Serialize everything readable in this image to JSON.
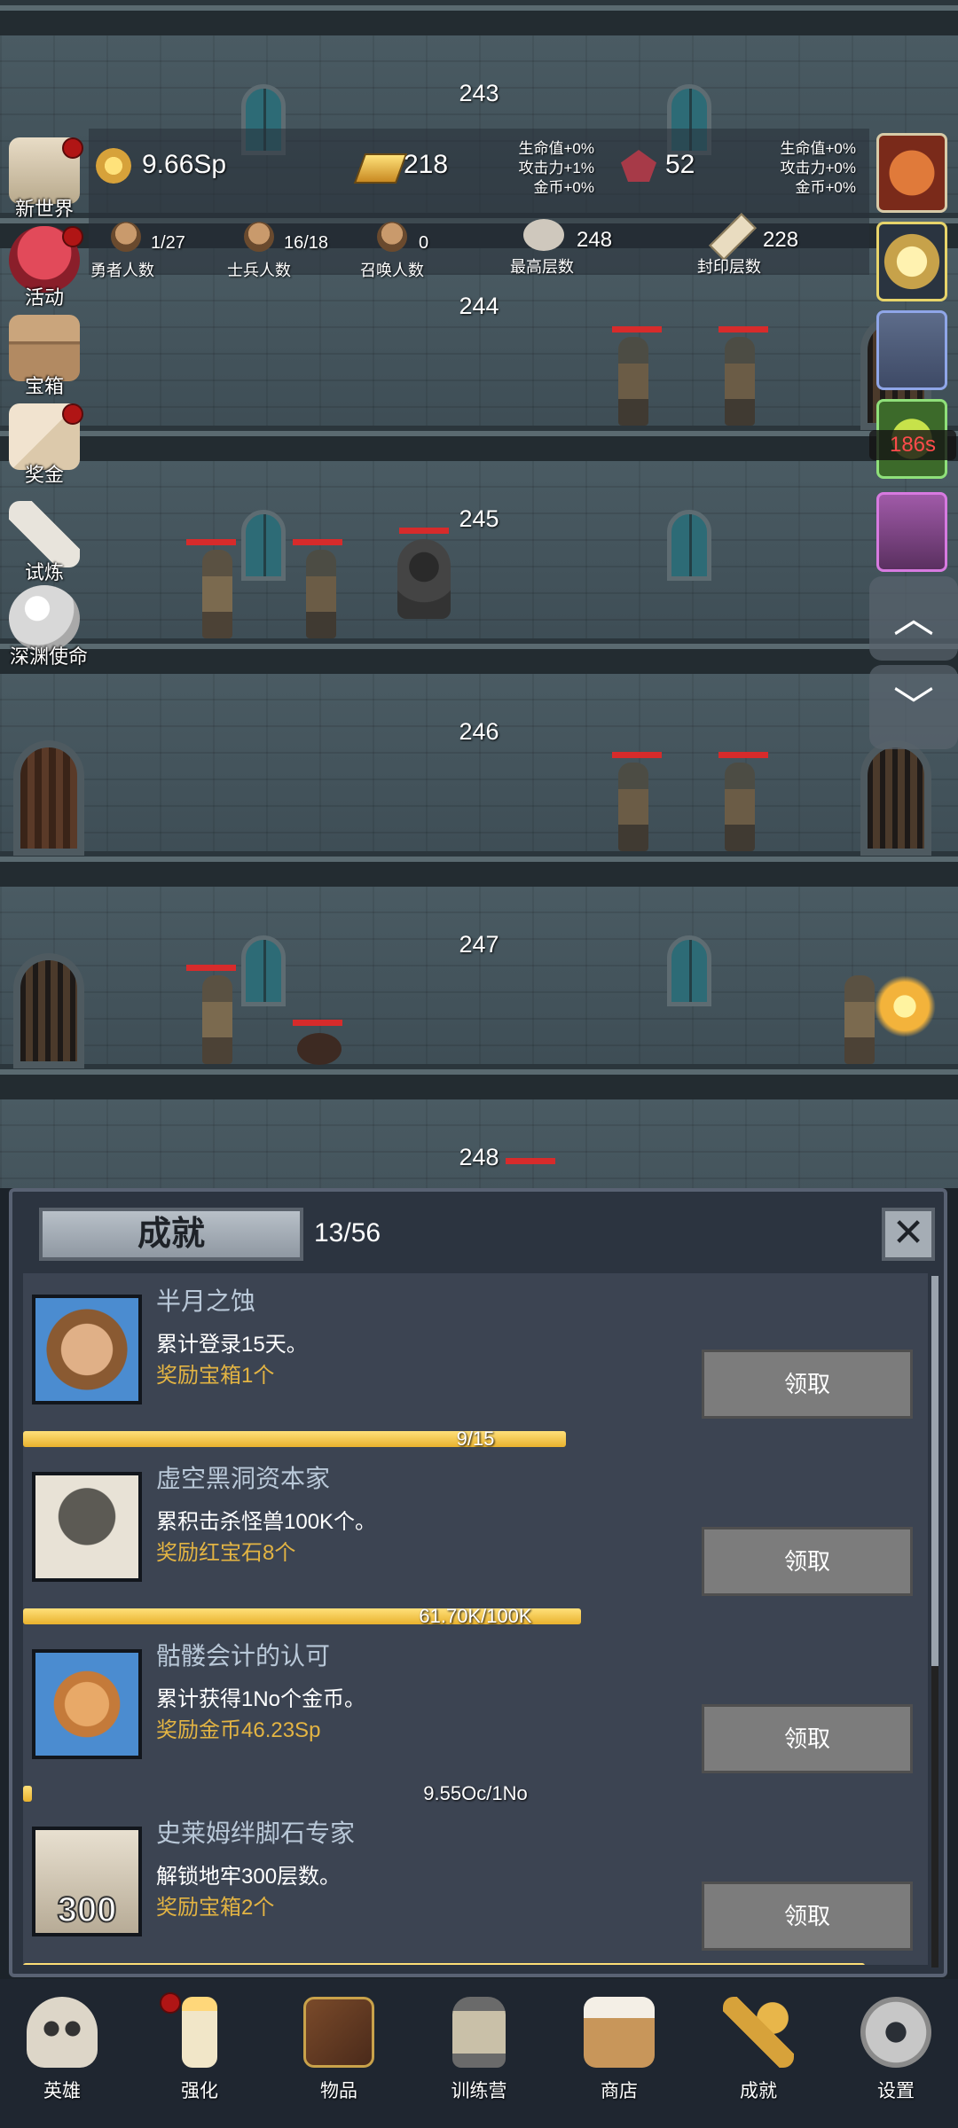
{
  "floors": [
    "243",
    "244",
    "245",
    "246",
    "247",
    "248"
  ],
  "hud": {
    "coins": "9.66Sp",
    "gold_bars": "218",
    "rubies": "52",
    "bonus_left": [
      "生命值+0%",
      "攻击力+1%",
      "金币+0%"
    ],
    "bonus_right": [
      "生命值+0%",
      "攻击力+0%",
      "金币+0%"
    ],
    "heroes": {
      "count": "1/27",
      "label": "勇者人数"
    },
    "soldiers": {
      "count": "16/18",
      "label": "士兵人数"
    },
    "summons": {
      "count": "0",
      "label": "召唤人数"
    },
    "max_floor": {
      "count": "248",
      "label": "最高层数"
    },
    "sealed_floor": {
      "count": "228",
      "label": "封印层数"
    }
  },
  "side_menu": [
    {
      "label": "新世界",
      "icon": "ruins-icon",
      "badge": true
    },
    {
      "label": "活动",
      "icon": "heart-icon",
      "badge": true
    },
    {
      "label": "宝箱",
      "icon": "treasure-chest-icon",
      "badge": false
    },
    {
      "label": "奖金",
      "icon": "letter-icon",
      "badge": true
    },
    {
      "label": "试炼",
      "icon": "feather-icon",
      "badge": false
    },
    {
      "label": "深渊使命",
      "icon": "pearl-icon",
      "badge": false
    }
  ],
  "right_column": {
    "timer": "186s",
    "scroll_up_icon": "chevron-up-icon",
    "scroll_down_icon": "chevron-down-icon"
  },
  "achievements": {
    "title": "成就",
    "progress": "13/56",
    "close_icon": "close-icon",
    "items": [
      {
        "title": "半月之蚀",
        "desc": "累计登录15天。",
        "reward": "奖励宝箱1个",
        "button": "领取",
        "progress_text": "9/15",
        "progress": 0.6,
        "icon": "hero-portrait-icon"
      },
      {
        "title": "虚空黑洞资本家",
        "desc": "累积击杀怪兽100K个。",
        "reward": "奖励红宝石8个",
        "button": "领取",
        "progress_text": "61.70K/100K",
        "progress": 0.617,
        "icon": "zombie-portrait-icon"
      },
      {
        "title": "骷髅会计的认可",
        "desc": "累计获得1No个金币。",
        "reward": "奖励金币46.23Sp",
        "button": "领取",
        "progress_text": "9.55Oc/1No",
        "progress": 0.01,
        "icon": "gold-coin-icon"
      },
      {
        "title": "史莱姆绊脚石专家",
        "desc": "解锁地牢300层数。",
        "reward": "奖励宝箱2个",
        "button": "领取",
        "progress_text": "",
        "progress": 0.93,
        "icon": "floor-300-icon",
        "icon_text": "300"
      }
    ]
  },
  "nav": [
    {
      "label": "英雄",
      "icon": "skull-icon",
      "badge": false
    },
    {
      "label": "强化",
      "icon": "candle-icon",
      "badge": true
    },
    {
      "label": "物品",
      "icon": "book-icon",
      "badge": false
    },
    {
      "label": "训练营",
      "icon": "lantern-icon",
      "badge": false
    },
    {
      "label": "商店",
      "icon": "beer-mug-icon",
      "badge": false
    },
    {
      "label": "成就",
      "icon": "key-icon",
      "badge": false
    },
    {
      "label": "设置",
      "icon": "gear-icon",
      "badge": false
    }
  ]
}
